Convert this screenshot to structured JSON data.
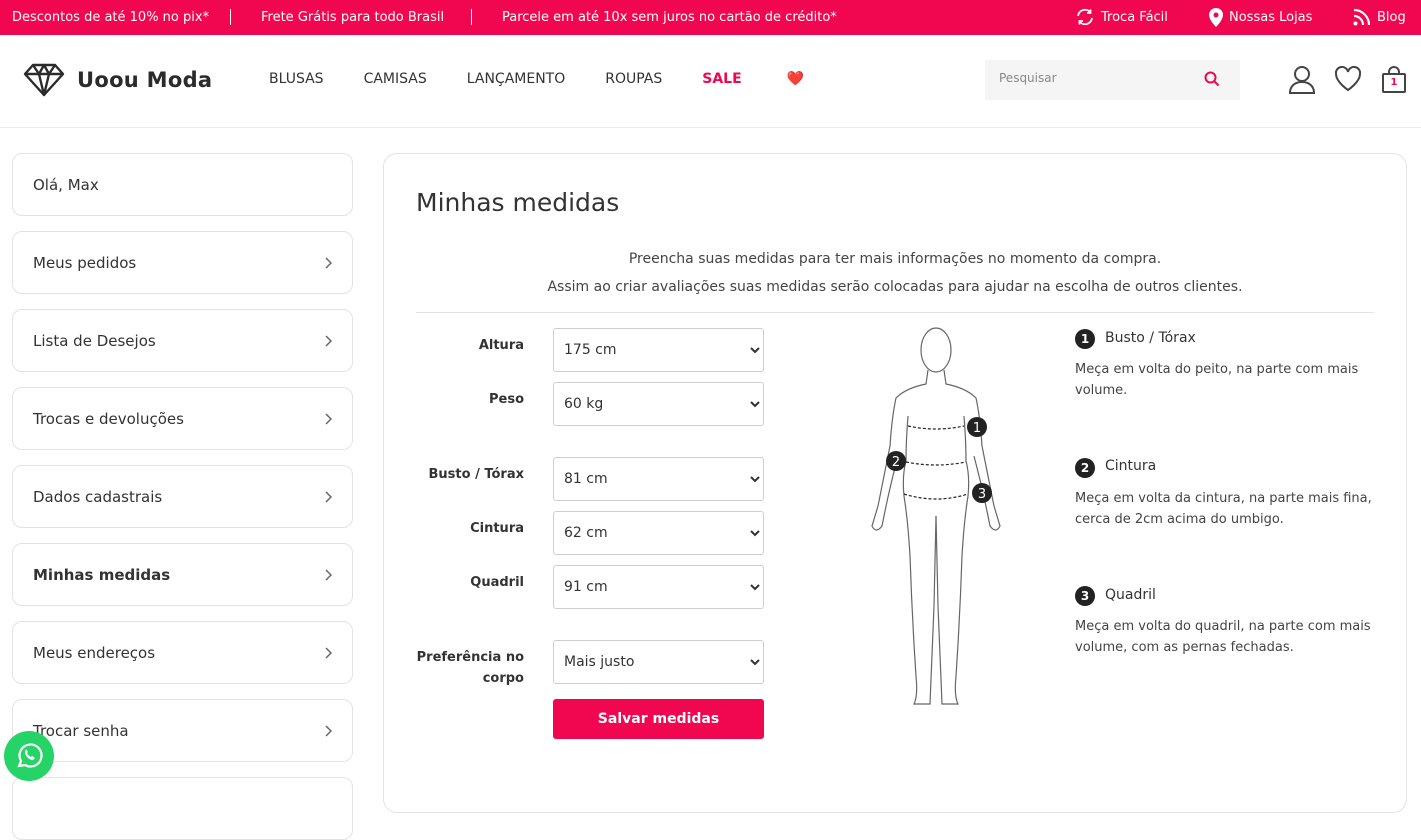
{
  "topbar": {
    "promo1": "Descontos de até 10% no pix*",
    "promo2": "Frete Grátis para todo Brasil",
    "promo3": "Parcele em até 10x sem juros no cartão de crédito*",
    "troca": "Troca Fácil",
    "lojas": "Nossas Lojas",
    "blog": "Blog",
    "color": "#f0074f"
  },
  "header": {
    "logo": "Uoou Moda",
    "nav": [
      "BLUSAS",
      "CAMISAS",
      "LANÇAMENTO",
      "ROUPAS",
      "SALE"
    ],
    "sale_emoji": "❤️",
    "search_placeholder": "Pesquisar",
    "cart_count": "1"
  },
  "sidebar": {
    "greeting": "Olá, Max",
    "items": [
      "Meus pedidos",
      "Lista de Desejos",
      "Trocas e devoluções",
      "Dados cadastrais",
      "Minhas medidas",
      "Meus endereços",
      "Trocar senha"
    ],
    "active": "Minhas medidas"
  },
  "main": {
    "title": "Minhas medidas",
    "intro1": "Preencha suas medidas para ter mais informações no momento da compra.",
    "intro2": "Assim ao criar avaliações suas medidas serão colocadas para ajudar na escolha de outros clientes.",
    "fields": [
      {
        "label": "Altura",
        "value": "175 cm"
      },
      {
        "label": "Peso",
        "value": "60 kg"
      },
      {
        "label": "Busto / Tórax",
        "value": "81 cm"
      },
      {
        "label": "Cintura",
        "value": "62 cm"
      },
      {
        "label": "Quadril",
        "value": "91 cm"
      },
      {
        "label": "Preferência no corpo",
        "value": "Mais justo"
      }
    ],
    "save_label": "Salvar medidas",
    "guide": [
      {
        "num": "1",
        "title": "Busto / Tórax",
        "desc": "Meça em volta do peito, na parte com mais volume."
      },
      {
        "num": "2",
        "title": "Cintura",
        "desc": "Meça em volta da cintura, na parte mais fina, cerca de 2cm acima do umbigo."
      },
      {
        "num": "3",
        "title": "Quadril",
        "desc": "Meça em volta do quadril, na parte com mais volume, com as pernas fechadas."
      }
    ]
  }
}
